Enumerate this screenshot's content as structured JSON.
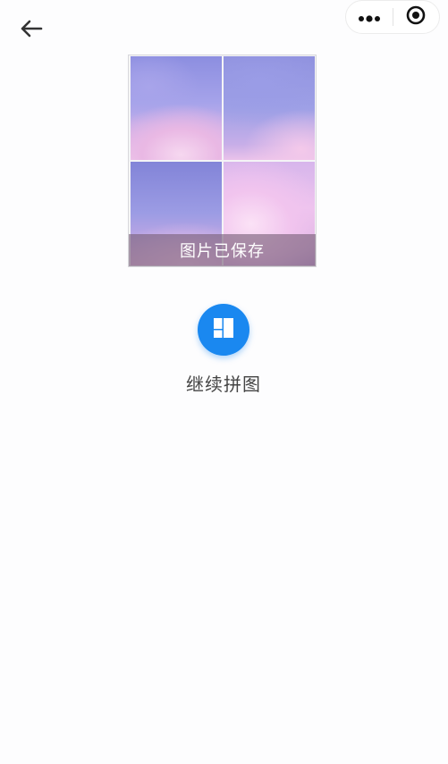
{
  "nav": {
    "back_icon": "arrow-left-icon",
    "capsule": {
      "more_icon": "more-dots-icon",
      "close_icon": "target-circle-icon"
    }
  },
  "preview": {
    "layout": "2x2-grid",
    "saved_text": "图片已保存"
  },
  "action": {
    "icon": "collage-grid-icon",
    "label": "继续拼图",
    "accent": "#1a88f0"
  }
}
